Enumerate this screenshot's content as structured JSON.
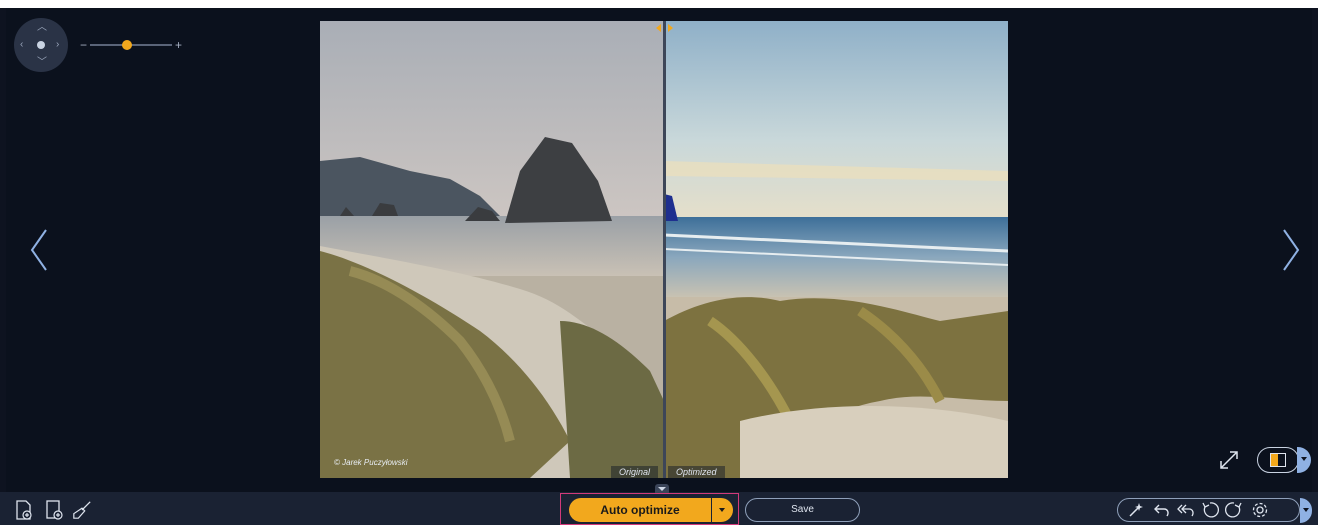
{
  "viewer": {
    "photo_credit": "© Jarek Puczyłowski",
    "original_label": "Original",
    "optimized_label": "Optimized",
    "zoom_minus": "−",
    "zoom_plus": "+",
    "zoom_level": 0.45
  },
  "toolbar": {
    "auto_optimize_label": "Auto optimize",
    "save_label": "Save"
  },
  "icons": {
    "left_group": [
      "new-document-icon",
      "add-document-icon",
      "clean-brush-icon"
    ],
    "right_group": [
      "magic-wand-icon",
      "undo-icon",
      "undo-all-icon",
      "rotate-left-icon",
      "rotate-right-icon",
      "settings-icon"
    ]
  },
  "colors": {
    "accent": "#f2a81d",
    "background": "#0e1320",
    "toolbar": "#1a2233",
    "highlight_border": "#d23a7a",
    "dropdown": "#8fb1e3"
  }
}
